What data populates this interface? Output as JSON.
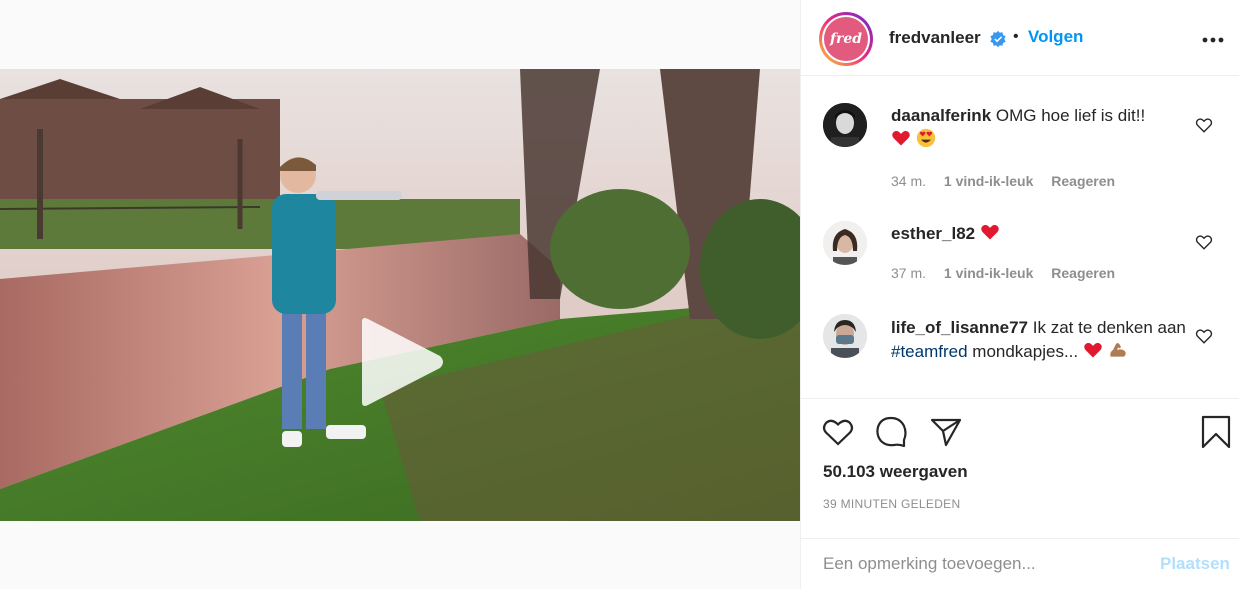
{
  "post": {
    "author": "fredvanleer",
    "avatar_text": "fred",
    "separator": "•",
    "follow_label": "Volgen",
    "views": "50.103 weergaven",
    "time_ago": "39 MINUTEN GELEDEN"
  },
  "comments": [
    {
      "user": "daanalferink",
      "text": "OMG hoe lief is dit!!",
      "emoji": [
        "red-heart",
        "heart-eyes-face"
      ],
      "age": "34 m.",
      "likes": "1 vind-ik-leuk",
      "reply": "Reageren"
    },
    {
      "user": "esther_l82",
      "text": "",
      "emoji": [
        "red-heart"
      ],
      "age": "37 m.",
      "likes": "1 vind-ik-leuk",
      "reply": "Reageren"
    },
    {
      "user": "life_of_lisanne77",
      "text": "Ik zat te denken aan",
      "hashtag": "#teamfred",
      "text2": "mondkapjes...",
      "emoji": [
        "red-heart",
        "flexed-biceps"
      ]
    }
  ],
  "composer": {
    "placeholder": "Een opmerking toevoegen...",
    "post_label": "Plaatsen"
  },
  "colors": {
    "accent": "#0095f6",
    "post_disabled": "#b2dffc",
    "heart": "#ed4956"
  }
}
